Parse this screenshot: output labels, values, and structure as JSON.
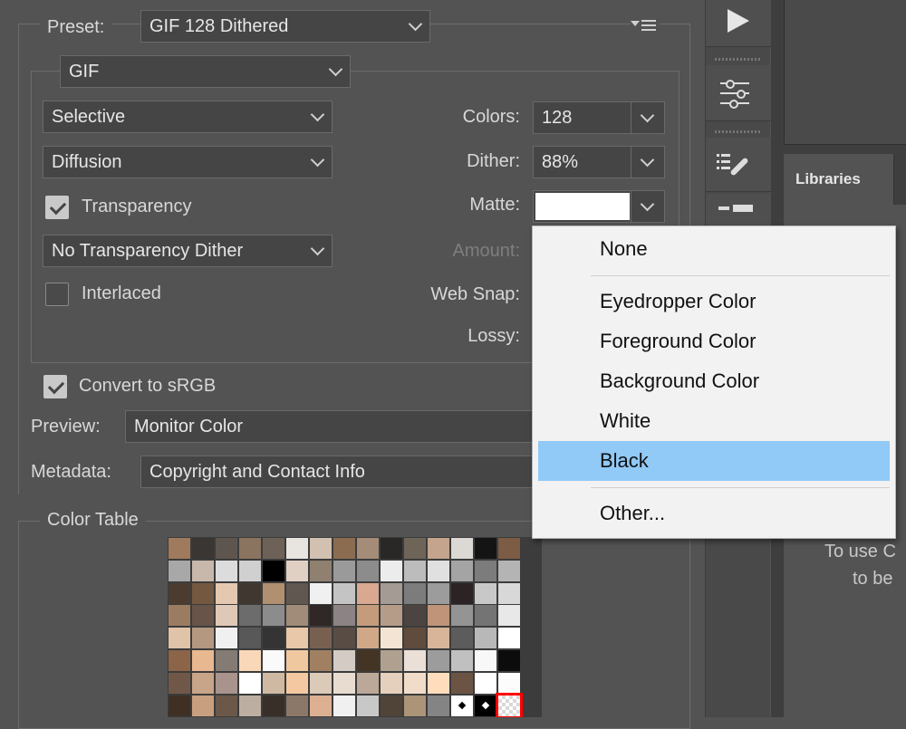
{
  "preset": {
    "label": "Preset:",
    "value": "GIF 128 Dithered"
  },
  "format": {
    "value": "GIF"
  },
  "reduction": {
    "value": "Selective"
  },
  "dither_algo": {
    "value": "Diffusion"
  },
  "transparency": {
    "label": "Transparency",
    "checked": true
  },
  "transparency_dither": {
    "value": "No Transparency Dither"
  },
  "interlaced": {
    "label": "Interlaced",
    "checked": false
  },
  "colors": {
    "label": "Colors:",
    "value": "128"
  },
  "dither": {
    "label": "Dither:",
    "value": "88%"
  },
  "matte": {
    "label": "Matte:",
    "color": "#ffffff"
  },
  "amount": {
    "label": "Amount:"
  },
  "web_snap": {
    "label": "Web Snap:"
  },
  "lossy": {
    "label": "Lossy:"
  },
  "convert_srgb": {
    "label": "Convert to sRGB",
    "checked": true
  },
  "preview": {
    "label": "Preview:",
    "value": "Monitor Color"
  },
  "metadata": {
    "label": "Metadata:",
    "value": "Copyright and Contact Info"
  },
  "color_table": {
    "label": "Color Table"
  },
  "libraries": {
    "tab": "Libraries",
    "hint_line1": "To use C",
    "hint_line2": "to be"
  },
  "matte_menu": {
    "items": [
      {
        "label": "None"
      },
      {
        "label": "Eyedropper Color"
      },
      {
        "label": "Foreground Color"
      },
      {
        "label": "Background Color"
      },
      {
        "label": "White"
      },
      {
        "label": "Black",
        "selected": true
      },
      {
        "label": "Other..."
      }
    ]
  },
  "colors_palette": {
    "selection_highlight": "#ff0000",
    "swatches": [
      "#a07a5c",
      "#3a3634",
      "#5e564e",
      "#8a7460",
      "#6e6258",
      "#e8e4e0",
      "#d2c0b0",
      "#8c6c50",
      "#a48c78",
      "#2a2826",
      "#6e6458",
      "#c4a48c",
      "#dcd8d4",
      "#141414",
      "#7c5c44",
      "#a8a8a8",
      "#c8b8ac",
      "#dcdcdc",
      "#d0d0d0",
      "#000000",
      "#e0d0c4",
      "#908070",
      "#9a9a9a",
      "#8c8c8c",
      "#ececec",
      "#bcbcbc",
      "#e0e0e0",
      "#a4a4a4",
      "#7c7c7c",
      "#b4b4b4",
      "#4c3c30",
      "#745840",
      "#e4c8b0",
      "#403830",
      "#b09070",
      "#605850",
      "#f0f0f0",
      "#c4c4c4",
      "#d8a890",
      "#a49c94",
      "#7c7c7c",
      "#9c9c9c",
      "#2c2424",
      "#c8c8c8",
      "#d8d8d8",
      "#9c7c60",
      "#685448",
      "#e0c8b8",
      "#6c6c6c",
      "#8c8c8c",
      "#a08c78",
      "#302826",
      "#8c8484",
      "#c49c7c",
      "#b49c88",
      "#4c4440",
      "#c09478",
      "#949494",
      "#747474",
      "#e8e8e8",
      "#e0c4a8",
      "#b49880",
      "#f0f0f0",
      "#585858",
      "#343434",
      "#e8c8a8",
      "#786050",
      "#584c44",
      "#d0a888",
      "#f4e4d4",
      "#604c3c",
      "#d8b498",
      "#5c5c5c",
      "#b8b8b8",
      "#ffffff",
      "#8c6448",
      "#e8b890",
      "#847c74",
      "#f8d8b8",
      "#fafafa",
      "#f0c8a0",
      "#a08060",
      "#d4ccc4",
      "#443424",
      "#b0a090",
      "#eae0d8",
      "#9c9c9c",
      "#c0c0c0",
      "#f8f8f8",
      "#0c0c0c",
      "#705848",
      "#c8a488",
      "#a8948c",
      "#ffffff",
      "#cfb9a3",
      "#f4c8a0",
      "#dccab8",
      "#e8dcd0",
      "#bca898",
      "#e4d0bc",
      "#f0dcc8",
      "#ffdcbc",
      "#6c5444",
      "#ffffff",
      "#fcfcfc",
      "#403024",
      "#c8a080",
      "#6c5848",
      "#bcaea0",
      "#383028",
      "#8c7868",
      "#dcb090",
      "#f0f0f0",
      "#c8c8c8",
      "#504438",
      "#ac9478",
      "#848484",
      "#ffffff",
      "#000000",
      "#f0f0f0"
    ]
  }
}
